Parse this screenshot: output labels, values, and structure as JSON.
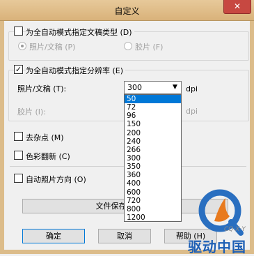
{
  "window": {
    "title": "自定义",
    "close_glyph": "✕"
  },
  "doc_type_group": {
    "checkbox_label": "为全自动模式指定文稿类型 (D)",
    "checked": false,
    "options": [
      {
        "label": "照片/文稿 (P)",
        "selected": true
      },
      {
        "label": "胶片 (F)",
        "selected": false
      }
    ]
  },
  "resolution_group": {
    "checkbox_label": "为全自动模式指定分辨率 (E)",
    "checked": true,
    "check_glyph": "✓",
    "photo_label": "照片/文稿 (T):",
    "photo_value": "300",
    "dropdown_arrow": "▼",
    "unit": "dpi",
    "film_label": "胶片 (I):",
    "film_unit": "dpi",
    "dropdown_options": [
      "50",
      "72",
      "96",
      "150",
      "200",
      "240",
      "266",
      "300",
      "350",
      "360",
      "400",
      "600",
      "720",
      "800",
      "1200"
    ],
    "highlighted_option": "50"
  },
  "options": {
    "despeckle_label": "去杂点 (M)",
    "color_restore_label": "色彩翻新 (C)",
    "auto_orient_label": "自动照片方向 (O)"
  },
  "buttons": {
    "file_save_settings": "文件保存设置 (S)",
    "ok": "确定",
    "cancel": "取消",
    "help": "帮助 (H)"
  },
  "watermark": {
    "text": "驱动中国",
    "sub": "CQ·X·Y",
    "colors": {
      "ring": "#2a6fc0",
      "flame": "#e87a1e",
      "text": "#1d5fb5"
    }
  }
}
